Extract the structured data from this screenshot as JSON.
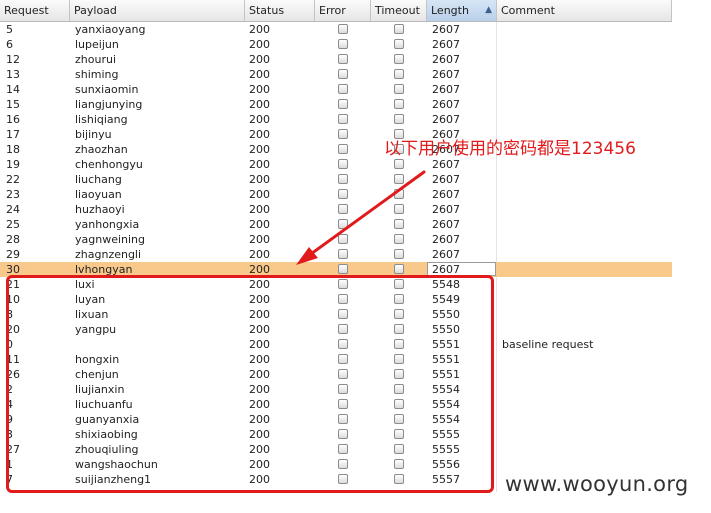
{
  "columns": [
    {
      "key": "request",
      "label": "Request"
    },
    {
      "key": "payload",
      "label": "Payload"
    },
    {
      "key": "status",
      "label": "Status"
    },
    {
      "key": "error",
      "label": "Error"
    },
    {
      "key": "timeout",
      "label": "Timeout"
    },
    {
      "key": "length",
      "label": "Length",
      "sorted": "ascending"
    },
    {
      "key": "comment",
      "label": "Comment"
    }
  ],
  "rows": [
    {
      "request": "5",
      "payload": "yanxiaoyang",
      "status": "200",
      "length": "2607",
      "comment": ""
    },
    {
      "request": "6",
      "payload": "lupeijun",
      "status": "200",
      "length": "2607",
      "comment": ""
    },
    {
      "request": "12",
      "payload": "zhourui",
      "status": "200",
      "length": "2607",
      "comment": ""
    },
    {
      "request": "13",
      "payload": "shiming",
      "status": "200",
      "length": "2607",
      "comment": ""
    },
    {
      "request": "14",
      "payload": "sunxiaomin",
      "status": "200",
      "length": "2607",
      "comment": ""
    },
    {
      "request": "15",
      "payload": "liangjunying",
      "status": "200",
      "length": "2607",
      "comment": ""
    },
    {
      "request": "16",
      "payload": "lishiqiang",
      "status": "200",
      "length": "2607",
      "comment": ""
    },
    {
      "request": "17",
      "payload": "bijinyu",
      "status": "200",
      "length": "2607",
      "comment": ""
    },
    {
      "request": "18",
      "payload": "zhaozhan",
      "status": "200",
      "length": "2607",
      "comment": ""
    },
    {
      "request": "19",
      "payload": "chenhongyu",
      "status": "200",
      "length": "2607",
      "comment": ""
    },
    {
      "request": "22",
      "payload": "liuchang",
      "status": "200",
      "length": "2607",
      "comment": ""
    },
    {
      "request": "23",
      "payload": "liaoyuan",
      "status": "200",
      "length": "2607",
      "comment": ""
    },
    {
      "request": "24",
      "payload": "huzhaoyi",
      "status": "200",
      "length": "2607",
      "comment": ""
    },
    {
      "request": "25",
      "payload": "yanhongxia",
      "status": "200",
      "length": "2607",
      "comment": ""
    },
    {
      "request": "28",
      "payload": "yagnweining",
      "status": "200",
      "length": "2607",
      "comment": ""
    },
    {
      "request": "29",
      "payload": "zhagnzengli",
      "status": "200",
      "length": "2607",
      "comment": ""
    },
    {
      "request": "30",
      "payload": "lvhongyan",
      "status": "200",
      "length": "2607",
      "comment": "",
      "selected": true
    },
    {
      "request": "21",
      "payload": "luxi",
      "status": "200",
      "length": "5548",
      "comment": ""
    },
    {
      "request": "10",
      "payload": "luyan",
      "status": "200",
      "length": "5549",
      "comment": ""
    },
    {
      "request": "8",
      "payload": "lixuan",
      "status": "200",
      "length": "5550",
      "comment": ""
    },
    {
      "request": "20",
      "payload": "yangpu",
      "status": "200",
      "length": "5550",
      "comment": ""
    },
    {
      "request": "0",
      "payload": "",
      "status": "200",
      "length": "5551",
      "comment": "baseline request"
    },
    {
      "request": "11",
      "payload": "hongxin",
      "status": "200",
      "length": "5551",
      "comment": ""
    },
    {
      "request": "26",
      "payload": "chenjun",
      "status": "200",
      "length": "5551",
      "comment": ""
    },
    {
      "request": "2",
      "payload": "liujianxin",
      "status": "200",
      "length": "5554",
      "comment": ""
    },
    {
      "request": "4",
      "payload": "liuchuanfu",
      "status": "200",
      "length": "5554",
      "comment": ""
    },
    {
      "request": "9",
      "payload": "guanyanxia",
      "status": "200",
      "length": "5554",
      "comment": ""
    },
    {
      "request": "3",
      "payload": "shixiaobing",
      "status": "200",
      "length": "5555",
      "comment": ""
    },
    {
      "request": "27",
      "payload": "zhouqiuling",
      "status": "200",
      "length": "5555",
      "comment": ""
    },
    {
      "request": "1",
      "payload": "wangshaochun",
      "status": "200",
      "length": "5556",
      "comment": ""
    },
    {
      "request": "7",
      "payload": "suijianzheng1",
      "status": "200",
      "length": "5557",
      "comment": ""
    }
  ],
  "annotation": {
    "text": "以下用户使用的密码都是123456",
    "color": "#e11b1b"
  },
  "watermark": "www.wooyun.org",
  "colors": {
    "selected_row": "#f9c98b",
    "annotation_red": "#e11b1b"
  }
}
